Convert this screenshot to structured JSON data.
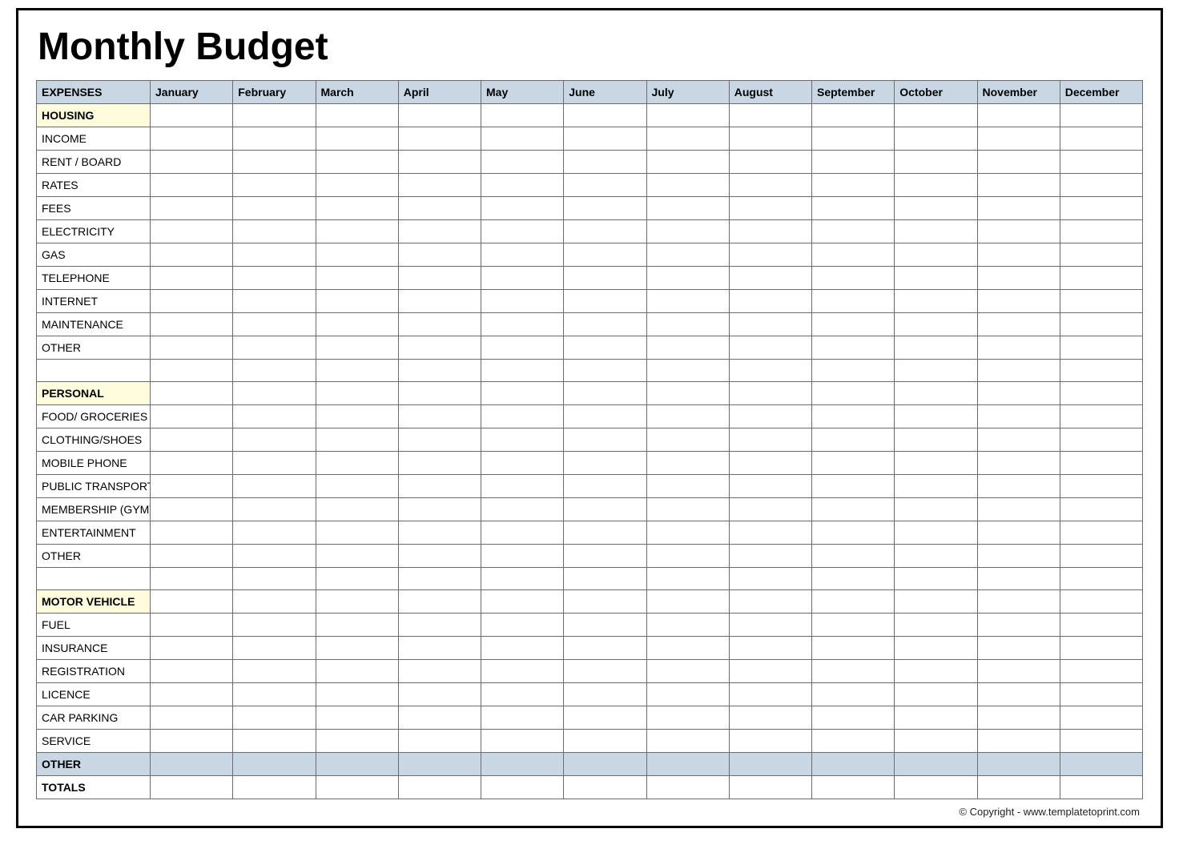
{
  "title": "Monthly Budget",
  "header": {
    "expenses": "EXPENSES",
    "months": [
      "January",
      "February",
      "March",
      "April",
      "May",
      "June",
      "July",
      "August",
      "September",
      "October",
      "November",
      "December"
    ]
  },
  "sections": [
    {
      "category": "HOUSING",
      "rows": [
        "INCOME",
        "RENT / BOARD",
        "RATES",
        "FEES",
        "ELECTRICITY",
        "GAS",
        "TELEPHONE",
        "INTERNET",
        "MAINTENANCE",
        "OTHER"
      ],
      "trailing_spacer": true
    },
    {
      "category": "PERSONAL",
      "rows": [
        "FOOD/ GROCERIES",
        "CLOTHING/SHOES",
        "MOBILE PHONE",
        "PUBLIC TRANSPORT",
        "MEMBERSHIP (GYM)",
        "ENTERTAINMENT",
        "OTHER"
      ],
      "trailing_spacer": true
    },
    {
      "category": "MOTOR VEHICLE",
      "rows": [
        "FUEL",
        "INSURANCE",
        "REGISTRATION",
        "LICENCE",
        "CAR PARKING",
        "SERVICE"
      ],
      "trailing_spacer": false
    }
  ],
  "other_row": "OTHER",
  "totals_row": "TOTALS",
  "footer": "© Copyright  -  www.templatetoprint.com"
}
